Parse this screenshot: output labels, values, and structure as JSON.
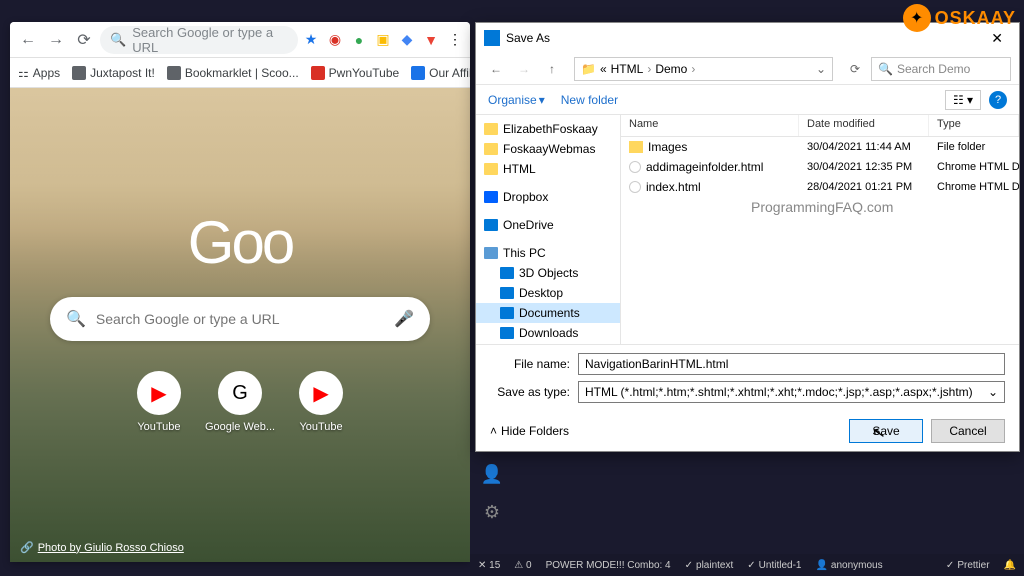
{
  "watermark": {
    "text": "OSKAAY"
  },
  "browser": {
    "omnibox_placeholder": "Search Google or type a URL",
    "bookmarks": [
      "Apps",
      "Juxtapost It!",
      "Bookmarklet | Scoo...",
      "PwnYouTube",
      "Our Affiliate Progra..."
    ],
    "google_logo": "Goo",
    "search_placeholder": "Search Google or type a URL",
    "shortcuts": [
      {
        "label": "YouTube",
        "glyph": "▶"
      },
      {
        "label": "Google Web...",
        "glyph": "G"
      },
      {
        "label": "YouTube",
        "glyph": "▶"
      }
    ],
    "photo_credit": "Photo by Giulio Rosso Chioso"
  },
  "dialog": {
    "title": "Save As",
    "breadcrumb": [
      "«",
      "HTML",
      "Demo"
    ],
    "search_placeholder": "Search Demo",
    "organise": "Organise",
    "new_folder": "New folder",
    "tree": [
      {
        "label": "ElizabethFoskaay",
        "icon": "folder"
      },
      {
        "label": "FoskaayWebmas",
        "icon": "folder"
      },
      {
        "label": "HTML",
        "icon": "folder"
      },
      {
        "label": "Dropbox",
        "icon": "db",
        "gap": true
      },
      {
        "label": "OneDrive",
        "icon": "od",
        "gap": true
      },
      {
        "label": "This PC",
        "icon": "pc",
        "gap": true
      },
      {
        "label": "3D Objects",
        "icon": "blue",
        "indent": true
      },
      {
        "label": "Desktop",
        "icon": "blue",
        "indent": true
      },
      {
        "label": "Documents",
        "icon": "blue",
        "indent": true,
        "selected": true
      },
      {
        "label": "Downloads",
        "icon": "blue",
        "indent": true
      }
    ],
    "columns": {
      "name": "Name",
      "date": "Date modified",
      "type": "Type"
    },
    "files": [
      {
        "name": "Images",
        "date": "30/04/2021 11:44 AM",
        "type": "File folder",
        "icon": "folder"
      },
      {
        "name": "addimageinfolder.html",
        "date": "30/04/2021 12:35 PM",
        "type": "Chrome HTML D",
        "icon": "html"
      },
      {
        "name": "index.html",
        "date": "28/04/2021 01:21 PM",
        "type": "Chrome HTML D",
        "icon": "html"
      }
    ],
    "watermark": "ProgrammingFAQ.com",
    "filename_label": "File name:",
    "filename_value": "NavigationBarinHTML.html",
    "saveas_label": "Save as type:",
    "saveas_value": "HTML (*.html;*.htm;*.shtml;*.xhtml;*.xht;*.mdoc;*.jsp;*.asp;*.aspx;*.jshtm)",
    "hide_folders": "Hide Folders",
    "save": "Save",
    "cancel": "Cancel"
  },
  "statusbar": {
    "errors": "✕ 15",
    "warnings": "⚠ 0",
    "power": "POWER MODE!!! Combo: 4",
    "lang": "plaintext",
    "file": "Untitled-1",
    "user": "anonymous",
    "prettier": "Prettier"
  }
}
